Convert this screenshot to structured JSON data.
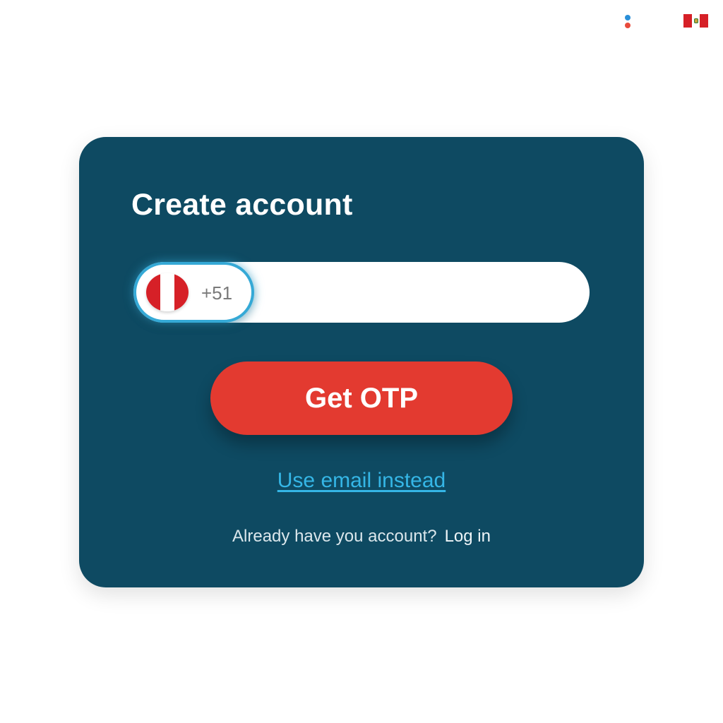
{
  "colors": {
    "page_background": "#ffffff",
    "card_background": "#0e4a62",
    "primary_button": "#e33a30",
    "link": "#35b6e6",
    "input_border_focus": "#35a9d6",
    "dial_code_text": "#7a7a7a",
    "flag_red": "#d62027",
    "flag_white": "#ffffff",
    "indicator_blue": "#2a8fd8",
    "indicator_red": "#e84b3c"
  },
  "top_bar": {
    "status_dots_icon": "status-dots-icon",
    "flag_icon": "peru-flag-icon"
  },
  "card": {
    "title": "Create account",
    "phone_field": {
      "flag_icon": "peru-flag-icon",
      "dial_code": "+51",
      "value": "",
      "placeholder": ""
    },
    "otp_button_label": "Get OTP",
    "email_link_label": "Use email instead",
    "login_prompt": "Already have you account?",
    "login_link_label": "Log in"
  }
}
